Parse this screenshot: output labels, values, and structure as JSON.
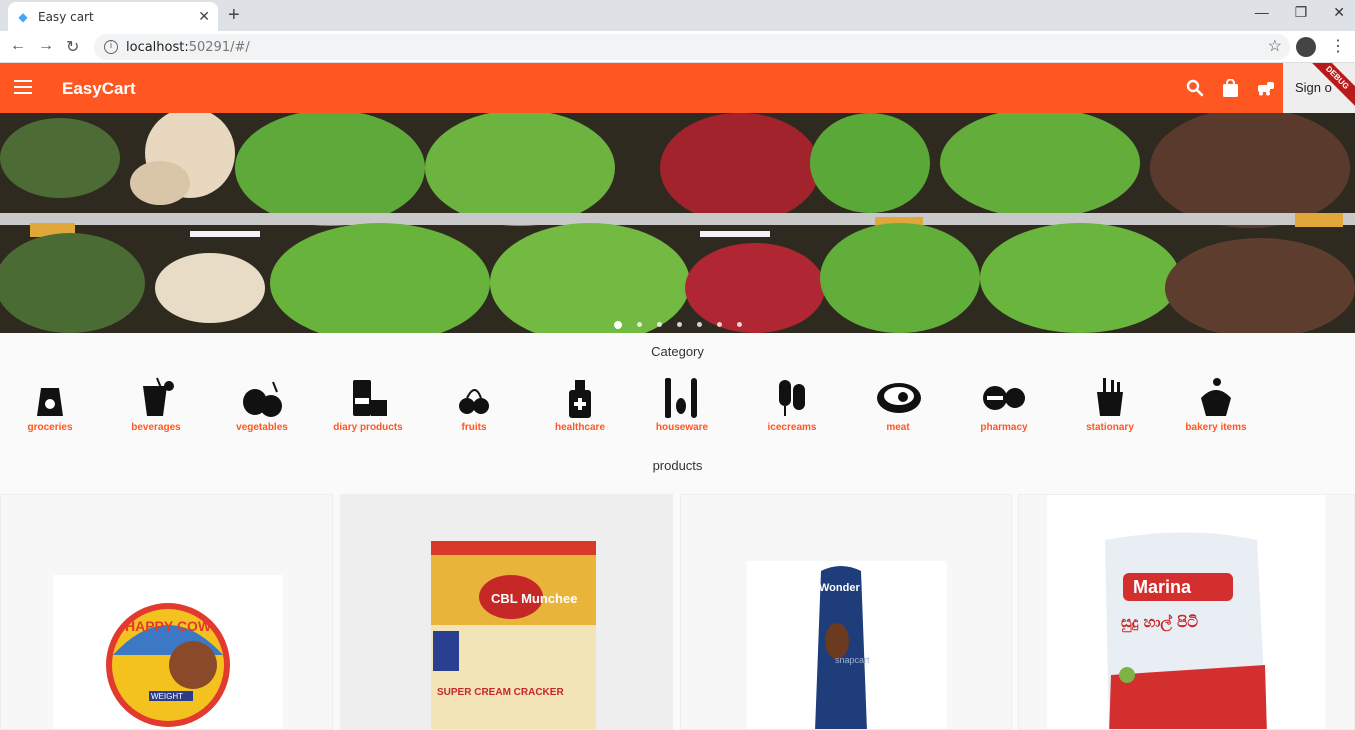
{
  "browser": {
    "tab_title": "Easy cart",
    "url_host": "localhost:",
    "url_rest": "50291/#/"
  },
  "appbar": {
    "brand": "EasyCart",
    "signout_label": "Sign o",
    "debug_label": "DEBUG",
    "icons": [
      "menu-icon",
      "search-icon",
      "shopping-bag-icon",
      "cart-icon"
    ],
    "color": "#ff5722"
  },
  "carousel": {
    "slide_count": 7,
    "active_index": 0
  },
  "categories": {
    "title": "Category",
    "items": [
      {
        "label": "groceries",
        "icon": "grocery-bag-icon"
      },
      {
        "label": "beverages",
        "icon": "drink-cup-icon"
      },
      {
        "label": "vegetables",
        "icon": "vegetables-icon"
      },
      {
        "label": "diary products",
        "icon": "dairy-icon"
      },
      {
        "label": "fruits",
        "icon": "cherry-icon"
      },
      {
        "label": "healthcare",
        "icon": "sanitizer-icon"
      },
      {
        "label": "houseware",
        "icon": "kitchen-utensils-icon"
      },
      {
        "label": "icecreams",
        "icon": "icecream-icon"
      },
      {
        "label": "meat",
        "icon": "steak-icon"
      },
      {
        "label": "pharmacy",
        "icon": "pills-icon"
      },
      {
        "label": "stationary",
        "icon": "pencil-cup-icon"
      },
      {
        "label": "bakery items",
        "icon": "cupcake-icon"
      }
    ]
  },
  "products": {
    "title": "products",
    "items": [
      {
        "name": "HAPPY COW",
        "sub": "WEIGHT"
      },
      {
        "name": "CBL Munchee",
        "sub": "SUPER CREAM CRACKER"
      },
      {
        "name": "Wonder Bar",
        "sub": "snapcart"
      },
      {
        "name": "Marina",
        "sub": "සුදු හාල් පිටි"
      }
    ]
  }
}
